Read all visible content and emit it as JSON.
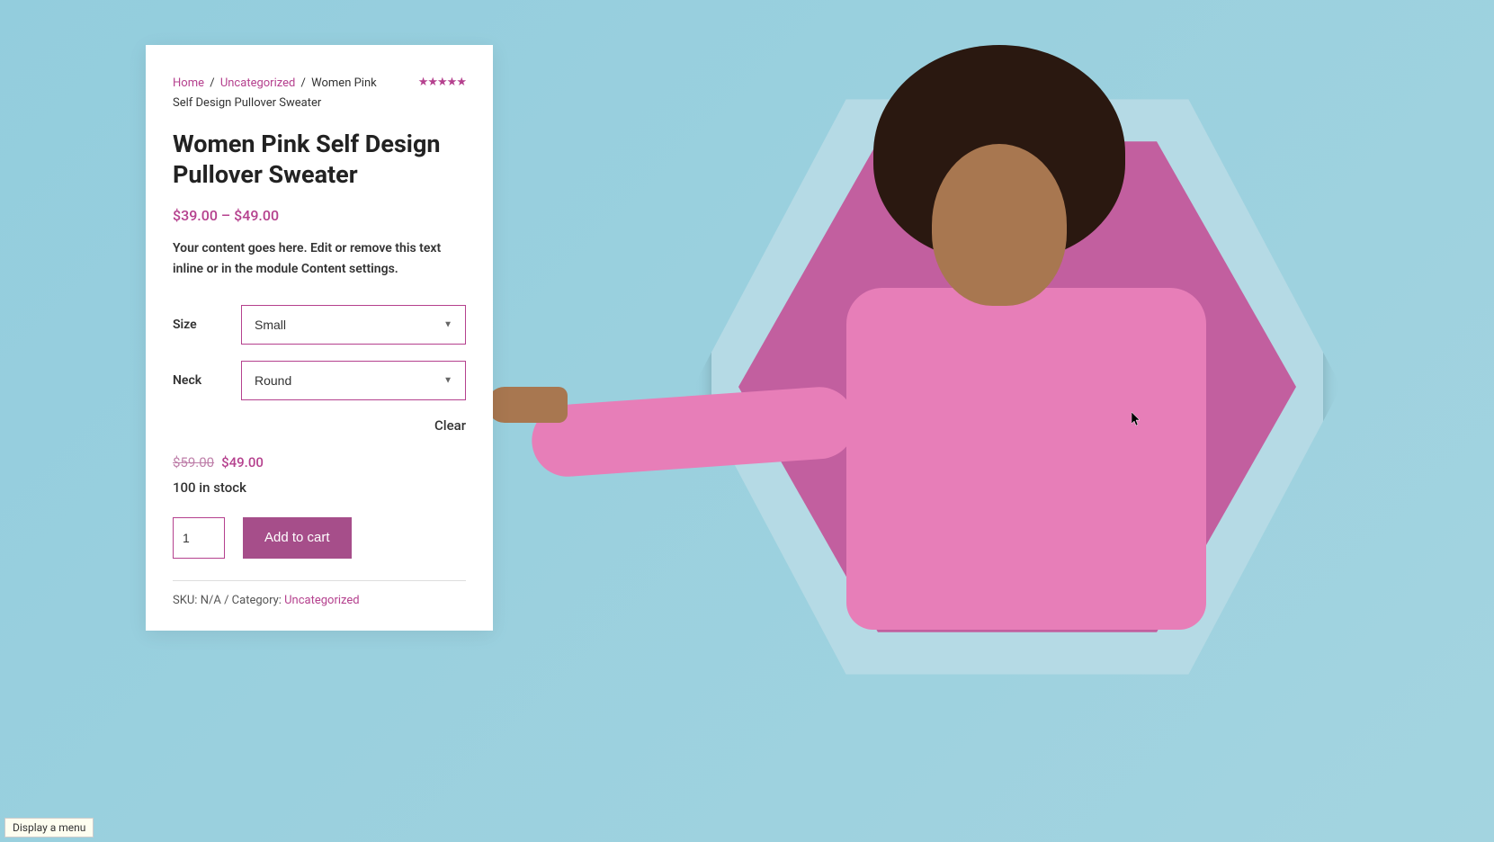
{
  "breadcrumb": {
    "home": "Home",
    "category": "Uncategorized",
    "current": "Women Pink Self Design Pullover Sweater"
  },
  "rating": {
    "stars": "★★★★★"
  },
  "product": {
    "title": "Women Pink Self Design Pullover Sweater",
    "price_range": "$39.00 – $49.00",
    "description": "Your content goes here. Edit or remove this text inline or in the module Content settings."
  },
  "variations": {
    "size_label": "Size",
    "size_value": "Small",
    "neck_label": "Neck",
    "neck_value": "Round",
    "clear": "Clear"
  },
  "pricing": {
    "old_price": "$59.00",
    "new_price": "$49.00"
  },
  "stock": "100 in stock",
  "cart": {
    "qty": "1",
    "add_label": "Add to cart"
  },
  "meta": {
    "sku_label": "SKU:",
    "sku_value": "N/A",
    "separator": "/",
    "category_label": "Category:",
    "category_value": "Uncategorized"
  },
  "tooltip": "Display a menu"
}
